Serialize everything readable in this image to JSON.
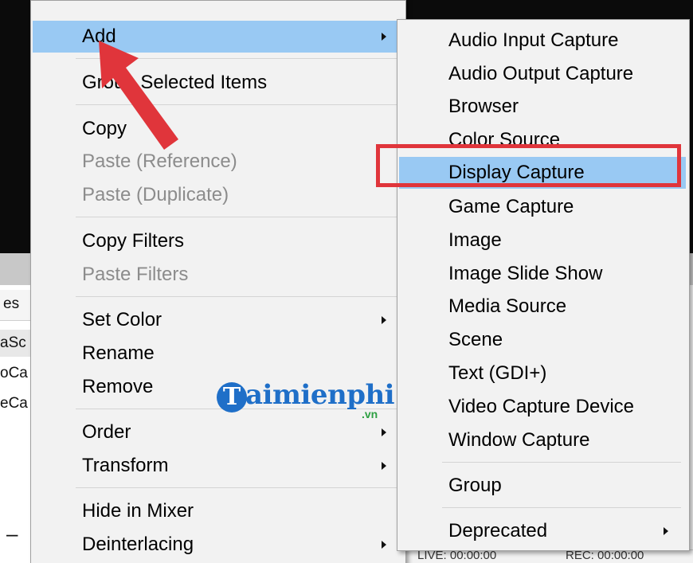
{
  "background": {
    "left_panel_header": "es",
    "left_panel_items": [
      "aSc",
      "oCa",
      "eCa"
    ],
    "dash": "–",
    "status_text": "LIVE: 00:00:00",
    "status_rec": "REC: 00:00:00"
  },
  "main_menu": {
    "items": [
      {
        "label": "Add",
        "has_submenu": true,
        "enabled": true,
        "highlighted": true
      },
      {
        "label": "Group Selected Items",
        "has_submenu": false,
        "enabled": true
      },
      {
        "label": "Copy",
        "has_submenu": false,
        "enabled": true
      },
      {
        "label": "Paste (Reference)",
        "has_submenu": false,
        "enabled": false
      },
      {
        "label": "Paste (Duplicate)",
        "has_submenu": false,
        "enabled": false
      },
      {
        "label": "Copy Filters",
        "has_submenu": false,
        "enabled": true
      },
      {
        "label": "Paste Filters",
        "has_submenu": false,
        "enabled": false
      },
      {
        "label": "Set Color",
        "has_submenu": true,
        "enabled": true
      },
      {
        "label": "Rename",
        "has_submenu": false,
        "enabled": true
      },
      {
        "label": "Remove",
        "has_submenu": false,
        "enabled": true
      },
      {
        "label": "Order",
        "has_submenu": true,
        "enabled": true
      },
      {
        "label": "Transform",
        "has_submenu": true,
        "enabled": true
      },
      {
        "label": "Hide in Mixer",
        "has_submenu": false,
        "enabled": true
      },
      {
        "label": "Deinterlacing",
        "has_submenu": true,
        "enabled": true
      }
    ]
  },
  "add_submenu": {
    "items": [
      {
        "label": "Audio Input Capture"
      },
      {
        "label": "Audio Output Capture"
      },
      {
        "label": "Browser"
      },
      {
        "label": "Color Source"
      },
      {
        "label": "Display Capture",
        "highlighted": true
      },
      {
        "label": "Game Capture"
      },
      {
        "label": "Image"
      },
      {
        "label": "Image Slide Show"
      },
      {
        "label": "Media Source"
      },
      {
        "label": "Scene"
      },
      {
        "label": "Text (GDI+)"
      },
      {
        "label": "Video Capture Device"
      },
      {
        "label": "Window Capture"
      },
      {
        "label": "Group"
      },
      {
        "label": "Deprecated",
        "has_submenu": true
      }
    ]
  },
  "watermark": {
    "logo_letter": "T",
    "brand": "aimienphi",
    "domain": ".vn"
  },
  "colors": {
    "menu_background": "#f2f2f2",
    "highlight": "#99c9f3",
    "disabled_text": "#8c8c8c",
    "annotation_red": "#e0353b",
    "watermark_blue": "#1f6fc8",
    "watermark_green": "#2ea043"
  }
}
